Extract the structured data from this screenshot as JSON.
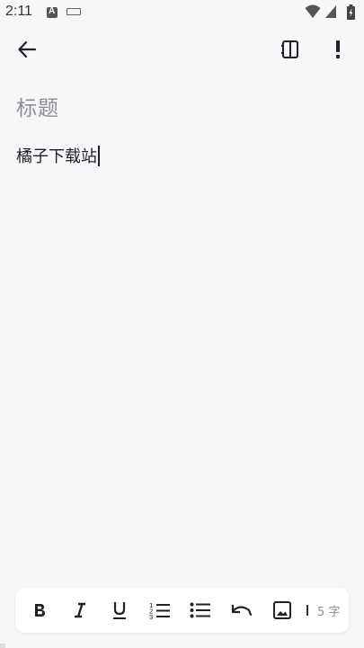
{
  "status_bar": {
    "time": "2:11",
    "icons": [
      "notification-a-icon",
      "keyboard-icon",
      "wifi-icon",
      "signal-icon",
      "battery-icon"
    ]
  },
  "top_bar": {
    "icons": [
      "back-arrow-icon",
      "side-panel-icon",
      "more-icon"
    ]
  },
  "editor": {
    "title_placeholder": "标题",
    "body": "橘子下载站"
  },
  "toolbar": {
    "icons": [
      "bold-icon",
      "italic-icon",
      "underline-icon",
      "ordered-list-icon",
      "bullet-list-icon",
      "undo-icon",
      "image-icon"
    ],
    "word_count": "5 字"
  },
  "colors": {
    "background": "#f6f7f9",
    "toolbar_bg": "#ffffff",
    "icon": "#202124",
    "muted_text": "#8c8d90"
  }
}
